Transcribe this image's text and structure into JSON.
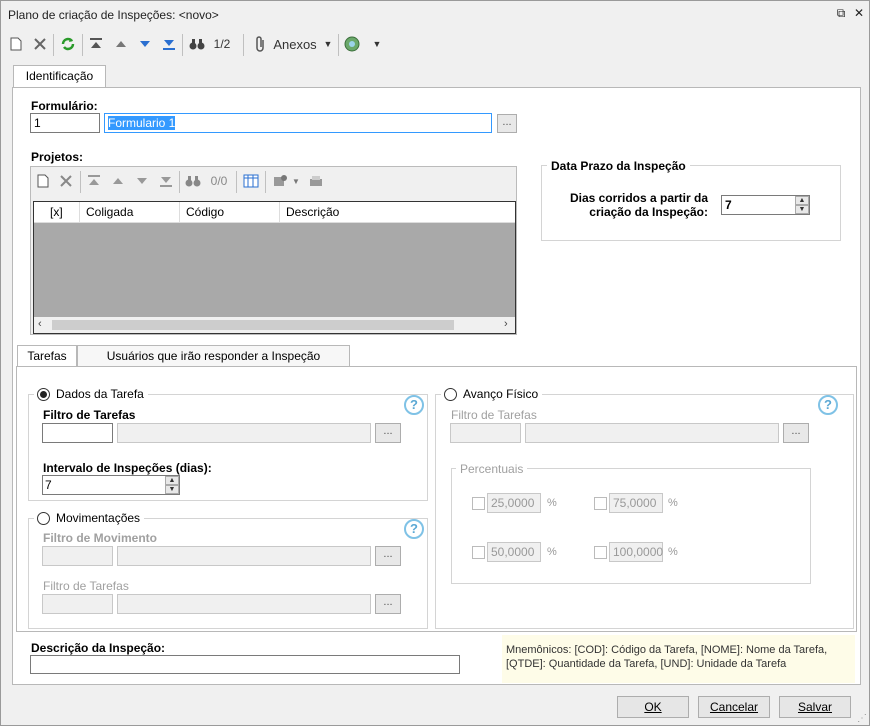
{
  "window": {
    "title": "Plano de criação de Inspeções: <novo>"
  },
  "toolbar": {
    "record_nav": "1/2",
    "attachments_label": "Anexos"
  },
  "tabs": {
    "main": "Identificação",
    "sub1": "Tarefas",
    "sub2": "Usuários que irão responder a Inspeção"
  },
  "form": {
    "formulario_label": "Formulário:",
    "formulario_code": "1",
    "formulario_name": "Formulario 1",
    "projetos_label": "Projetos:",
    "projetos_nav": "0/0",
    "projetos_columns": [
      "[x]",
      "Coligada",
      "Código",
      "Descrição"
    ]
  },
  "prazo": {
    "title": "Data Prazo da Inspeção",
    "label_line1": "Dias corridos a partir da",
    "label_line2": "criação da Inspeção:",
    "value": "7"
  },
  "dados_tarefa": {
    "radio_label": "Dados da Tarefa",
    "filtro_label": "Filtro de Tarefas",
    "filtro_value": "",
    "intervalo_label": "Intervalo de Inspeções (dias):",
    "intervalo_value": "7",
    "selected": true
  },
  "movimentacoes": {
    "radio_label": "Movimentações",
    "filtro_mov_label": "Filtro de Movimento",
    "filtro_tar_label": "Filtro de Tarefas"
  },
  "avanco_fisico": {
    "radio_label": "Avanço Físico",
    "filtro_label": "Filtro de Tarefas",
    "percentuais_label": "Percentuais",
    "percents": [
      "25,0000",
      "75,0000",
      "50,0000",
      "100,0000"
    ],
    "unit": "%"
  },
  "descricao": {
    "label": "Descrição da Inspeção:",
    "value": ""
  },
  "mnemonics": {
    "line1": "Mnemônicos: [COD]: Código da Tarefa, [NOME]: Nome da Tarefa,",
    "line2": "[QTDE]: Quantidade da Tarefa, [UND]: Unidade da Tarefa"
  },
  "footer": {
    "ok": "OK",
    "cancel": "Cancelar",
    "save": "Salvar"
  },
  "help_glyph": "?",
  "colors": {
    "accent": "#3399ff",
    "help": "#5ba8d4",
    "mnemonic_bg": "#fefce8"
  }
}
